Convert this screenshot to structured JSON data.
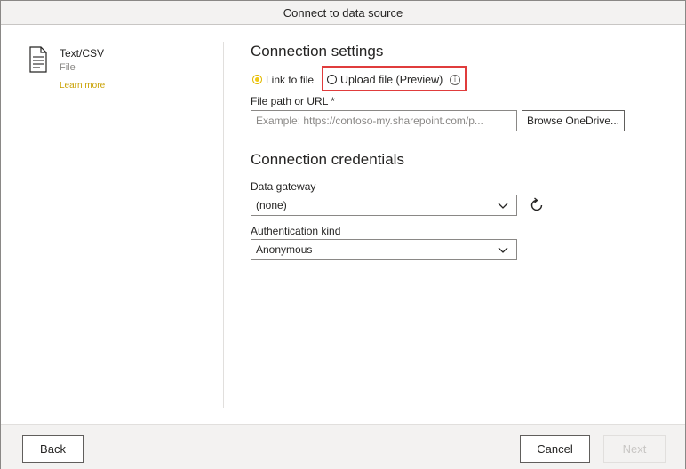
{
  "window": {
    "title": "Connect to data source"
  },
  "datasource": {
    "icon": "file-text-icon",
    "name": "Text/CSV",
    "category": "File",
    "learn_more": "Learn more"
  },
  "connection_settings": {
    "heading": "Connection settings",
    "radio_link": {
      "label": "Link to file",
      "selected": true
    },
    "radio_upload": {
      "label": "Upload file (Preview)",
      "selected": false,
      "info_icon": "info-icon"
    },
    "file_path": {
      "label": "File path or URL *",
      "value": "",
      "placeholder": "Example: https://contoso-my.sharepoint.com/p..."
    },
    "browse_label": "Browse OneDrive..."
  },
  "connection_credentials": {
    "heading": "Connection credentials",
    "gateway": {
      "label": "Data gateway",
      "selected": "(none)",
      "refresh_icon": "refresh-icon"
    },
    "auth": {
      "label": "Authentication kind",
      "selected": "Anonymous"
    }
  },
  "footer": {
    "back_label": "Back",
    "cancel_label": "Cancel",
    "next_label": "Next",
    "next_enabled": false
  },
  "colors": {
    "accent": "#f2c811",
    "highlight": "#e03c3c",
    "learn_more": "#c8a000"
  }
}
